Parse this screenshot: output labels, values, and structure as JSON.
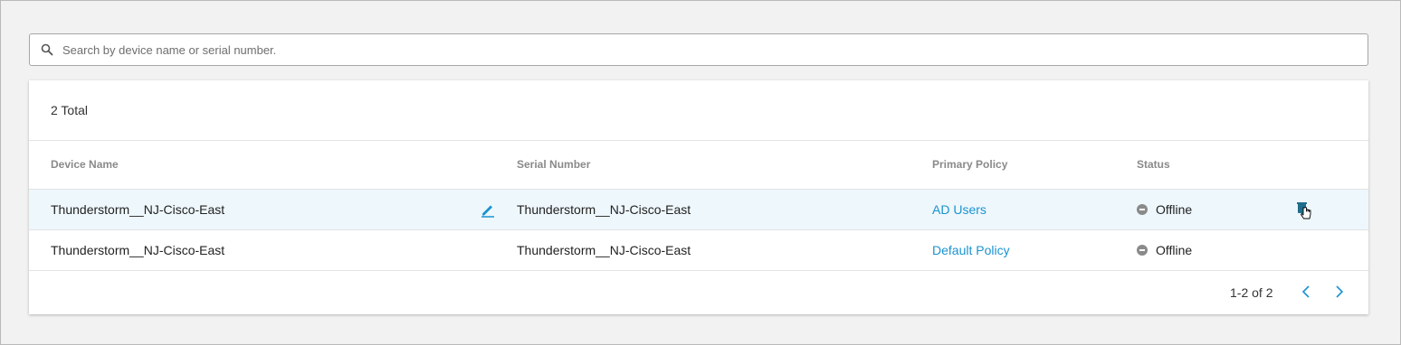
{
  "search": {
    "placeholder": "Search by device name or serial number.",
    "value": ""
  },
  "table": {
    "total_label": "2 Total",
    "columns": {
      "device_name": "Device Name",
      "serial_number": "Serial Number",
      "primary_policy": "Primary Policy",
      "status": "Status"
    },
    "rows": [
      {
        "device_name": "Thunderstorm__NJ-Cisco-East",
        "serial_number": "Thunderstorm__NJ-Cisco-East",
        "primary_policy": "AD Users",
        "status": "Offline"
      },
      {
        "device_name": "Thunderstorm__NJ-Cisco-East",
        "serial_number": "Thunderstorm__NJ-Cisco-East",
        "primary_policy": "Default Policy",
        "status": "Offline"
      }
    ]
  },
  "pagination": {
    "range_label": "1-2 of 2"
  },
  "icons": {
    "search": "search-icon",
    "edit": "pencil-icon",
    "status": "offline-status-icon",
    "prev": "chevron-left-icon",
    "next": "chevron-right-icon",
    "cursor": "hand-cursor-icon"
  },
  "colors": {
    "link": "#1a93d0",
    "highlight_row": "#eef7fc",
    "status_offline": "#8a8a8a",
    "header_text": "#8a8a8a"
  }
}
